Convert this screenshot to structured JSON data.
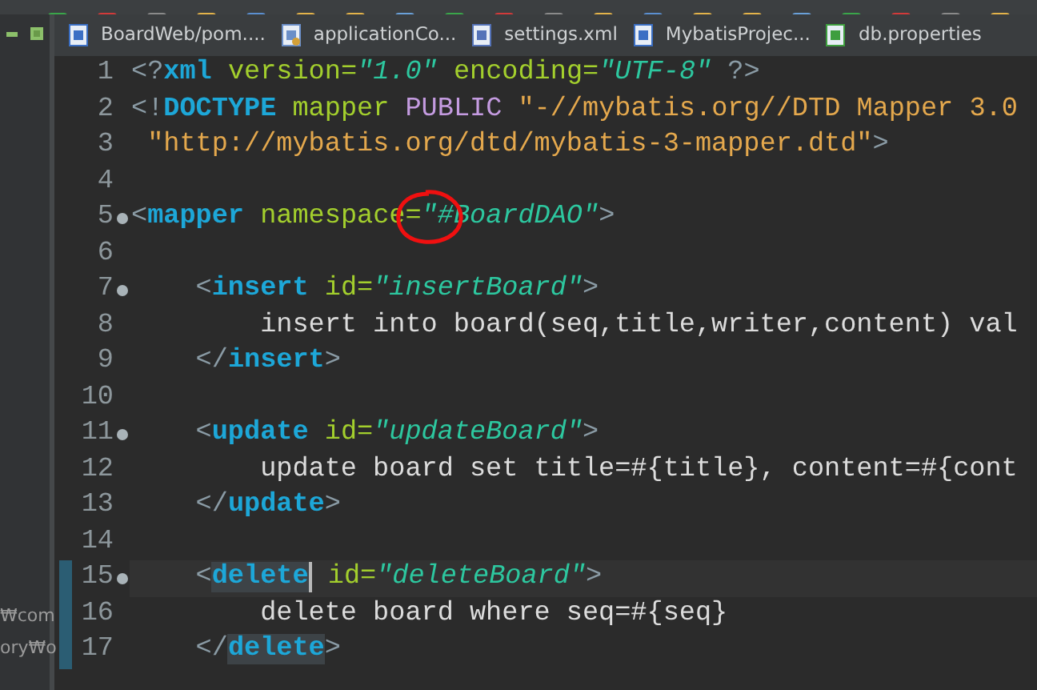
{
  "side_panel": {
    "texts": [
      "₩com",
      "ory₩o"
    ]
  },
  "tabs": [
    {
      "label": "BoardWeb/pom....",
      "kind": "maven",
      "selected": false
    },
    {
      "label": "applicationCo...",
      "kind": "spring",
      "selected": false
    },
    {
      "label": "settings.xml",
      "kind": "xml",
      "selected": false
    },
    {
      "label": "MybatisProjec...",
      "kind": "maven",
      "selected": false
    },
    {
      "label": "db.properties",
      "kind": "properties",
      "selected": false
    }
  ],
  "editor": {
    "lines": [
      {
        "number": "1",
        "fold": false,
        "current": false,
        "changed": false,
        "tokens": [
          {
            "kind": "punct",
            "text": "<?"
          },
          {
            "kind": "tag",
            "text": "xml"
          },
          {
            "kind": "attr",
            "text": " version="
          },
          {
            "kind": "value",
            "text": "\"1.0\""
          },
          {
            "kind": "attr",
            "text": " encoding="
          },
          {
            "kind": "value",
            "text": "\"UTF-8\""
          },
          {
            "kind": "punct",
            "text": " ?>"
          }
        ]
      },
      {
        "number": "2",
        "fold": false,
        "current": false,
        "changed": false,
        "tokens": [
          {
            "kind": "punct",
            "text": "<!"
          },
          {
            "kind": "tag",
            "text": "DOCTYPE"
          },
          {
            "kind": "attr",
            "text": " mapper"
          },
          {
            "kind": "keyword",
            "text": " PUBLIC"
          },
          {
            "kind": "string",
            "text": " \"-//mybatis.org//DTD Mapper 3.0"
          }
        ]
      },
      {
        "number": "3",
        "fold": false,
        "current": false,
        "changed": false,
        "tokens": [
          {
            "kind": "string",
            "text": " \"http://mybatis.org/dtd/mybatis-3-mapper.dtd\""
          },
          {
            "kind": "punct",
            "text": ">"
          }
        ]
      },
      {
        "number": "4",
        "fold": false,
        "current": false,
        "changed": false
      },
      {
        "number": "5",
        "fold": true,
        "current": false,
        "changed": false,
        "tokens": [
          {
            "kind": "punct",
            "text": "<"
          },
          {
            "kind": "tag",
            "text": "mapper"
          },
          {
            "kind": "attr",
            "text": " namespace="
          },
          {
            "kind": "value",
            "text": "\"#BoardDAO\"",
            "circled": true
          },
          {
            "kind": "punct",
            "text": ">"
          }
        ]
      },
      {
        "number": "6",
        "fold": false,
        "current": false,
        "changed": false
      },
      {
        "number": "7",
        "fold": true,
        "current": false,
        "changed": false,
        "tokens": [
          {
            "kind": "punct",
            "text": "    <"
          },
          {
            "kind": "tag",
            "text": "insert"
          },
          {
            "kind": "attr",
            "text": " id="
          },
          {
            "kind": "value",
            "text": "\"insertBoard\""
          },
          {
            "kind": "punct",
            "text": ">"
          }
        ]
      },
      {
        "number": "8",
        "fold": false,
        "current": false,
        "changed": false,
        "tokens": [
          {
            "kind": "text",
            "text": "        insert into board(seq,title,writer,content) val"
          }
        ]
      },
      {
        "number": "9",
        "fold": false,
        "current": false,
        "changed": false,
        "tokens": [
          {
            "kind": "punct",
            "text": "    </"
          },
          {
            "kind": "tag",
            "text": "insert"
          },
          {
            "kind": "punct",
            "text": ">"
          }
        ]
      },
      {
        "number": "10",
        "fold": false,
        "current": false,
        "changed": false
      },
      {
        "number": "11",
        "fold": true,
        "current": false,
        "changed": false,
        "tokens": [
          {
            "kind": "punct",
            "text": "    <"
          },
          {
            "kind": "tag",
            "text": "update"
          },
          {
            "kind": "attr",
            "text": " id="
          },
          {
            "kind": "value",
            "text": "\"updateBoard\""
          },
          {
            "kind": "punct",
            "text": ">"
          }
        ]
      },
      {
        "number": "12",
        "fold": false,
        "current": false,
        "changed": false,
        "tokens": [
          {
            "kind": "text",
            "text": "        update board set title=#{title}, content=#{cont"
          }
        ]
      },
      {
        "number": "13",
        "fold": false,
        "current": false,
        "changed": false,
        "tokens": [
          {
            "kind": "punct",
            "text": "    </"
          },
          {
            "kind": "tag",
            "text": "update"
          },
          {
            "kind": "punct",
            "text": ">"
          }
        ]
      },
      {
        "number": "14",
        "fold": false,
        "current": false,
        "changed": false
      },
      {
        "number": "15",
        "fold": true,
        "current": true,
        "changed": true,
        "tokens": [
          {
            "kind": "punct",
            "text": "    <"
          },
          {
            "kind": "tag",
            "text": "delete",
            "highlighted": true,
            "caret": true
          },
          {
            "kind": "attr",
            "text": " id="
          },
          {
            "kind": "value",
            "text": "\"deleteBoard\""
          },
          {
            "kind": "punct",
            "text": ">"
          }
        ]
      },
      {
        "number": "16",
        "fold": false,
        "current": false,
        "changed": true,
        "tokens": [
          {
            "kind": "text",
            "text": "        delete board where seq=#{seq}"
          }
        ]
      },
      {
        "number": "17",
        "fold": false,
        "current": false,
        "changed": true,
        "tokens": [
          {
            "kind": "punct",
            "text": "    </"
          },
          {
            "kind": "tag",
            "text": "delete",
            "highlighted": true
          },
          {
            "kind": "punct",
            "text": ">"
          }
        ]
      }
    ]
  }
}
